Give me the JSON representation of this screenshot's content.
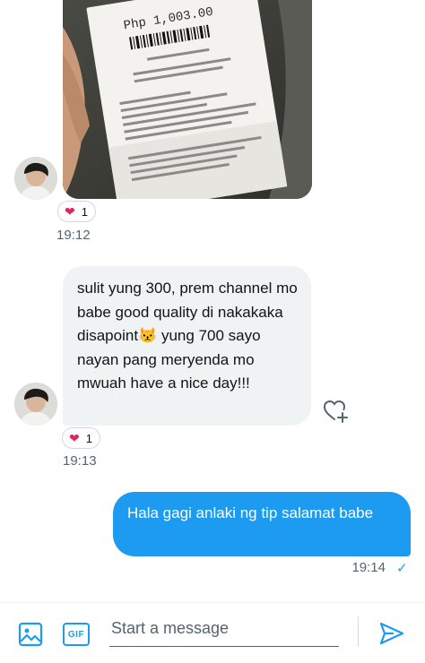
{
  "colors": {
    "accent": "#1d9bf0",
    "bubble_in": "#eff3f4",
    "heart": "#e0245e",
    "muted_text": "#536471"
  },
  "messages": [
    {
      "type": "image",
      "from": "them",
      "receipt_amount": "Php 1,003.00",
      "reaction": {
        "icon": "heart-icon",
        "count": "1"
      },
      "time": "19:12"
    },
    {
      "type": "text",
      "from": "them",
      "text_parts": [
        "sulit yung 300, prem channel mo babe good quality di nakakaka disapoint",
        " yung 700 sayo nayan pang meryenda mo mwuah have a nice day!!!"
      ],
      "emoji": "😾",
      "reaction": {
        "icon": "heart-icon",
        "count": "1"
      },
      "time": "19:13"
    },
    {
      "type": "text",
      "from": "me",
      "text": "Hala gagi anlaki ng tip salamat babe",
      "time": "19:14",
      "status_icon": "check-icon"
    }
  ],
  "composer": {
    "placeholder": "Start a message",
    "gif_label": "GIF",
    "icons": [
      "image-icon",
      "gif-icon",
      "send-icon"
    ]
  }
}
